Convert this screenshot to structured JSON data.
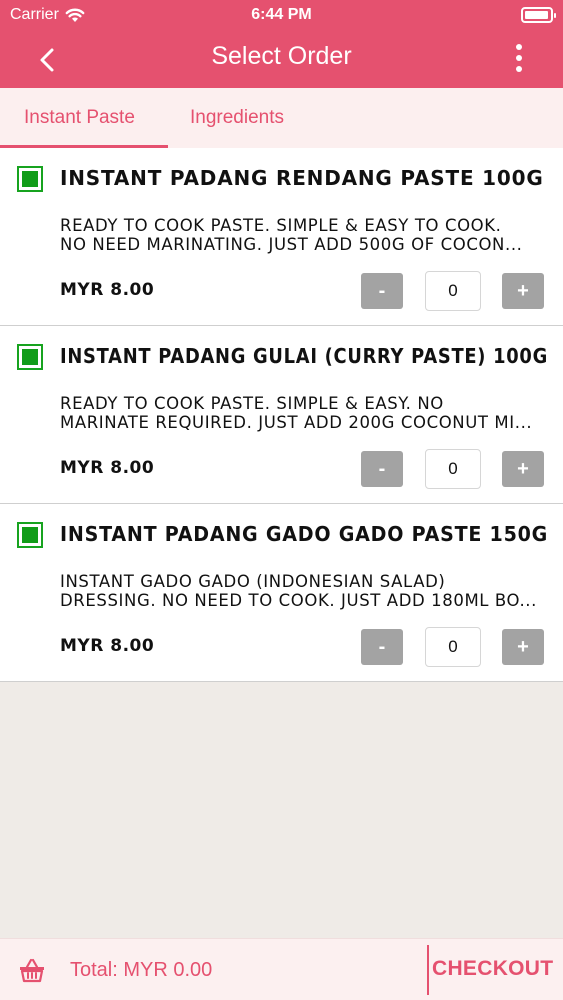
{
  "status_bar": {
    "carrier": "Carrier",
    "time": "6:44 PM",
    "battery_level": 0.95
  },
  "header": {
    "title": "Select Order"
  },
  "tabs": [
    {
      "label": "Instant Paste",
      "active": true
    },
    {
      "label": "Ingredients",
      "active": false
    }
  ],
  "products": [
    {
      "name": "INSTANT PADANG RENDANG PASTE 100G",
      "desc_line1": "READY TO COOK PASTE. SIMPLE & EASY TO COOK.",
      "desc_line2": "NO NEED MARINATING. JUST ADD 500G OF COCON...",
      "price": "MYR 8.00",
      "minus": "-",
      "qty": "0",
      "plus": "+"
    },
    {
      "name": "INSTANT PADANG GULAI (CURRY PASTE) 100G",
      "desc_line1": "READY TO COOK PASTE. SIMPLE & EASY. NO",
      "desc_line2": "MARINATE REQUIRED. JUST ADD 200G COCONUT MI...",
      "price": "MYR 8.00",
      "minus": "-",
      "qty": "0",
      "plus": "+"
    },
    {
      "name": "INSTANT PADANG GADO GADO PASTE 150G",
      "desc_line1": "INSTANT GADO GADO (INDONESIAN SALAD)",
      "desc_line2": "DRESSING. NO NEED TO COOK. JUST ADD 180ML BO...",
      "price": "MYR 8.00",
      "minus": "-",
      "qty": "0",
      "plus": "+"
    }
  ],
  "footer": {
    "total": "Total: MYR 0.00",
    "checkout": "CHECKOUT"
  },
  "colors": {
    "brand": "#e5516f",
    "check": "#119c19",
    "stepper": "#a3a3a3"
  },
  "icons": {
    "back": "chevron-left-icon",
    "menu": "more-vertical-icon",
    "basket": "basket-icon",
    "wifi": "wifi-icon",
    "battery": "battery-icon",
    "check": "checkbox-icon"
  }
}
